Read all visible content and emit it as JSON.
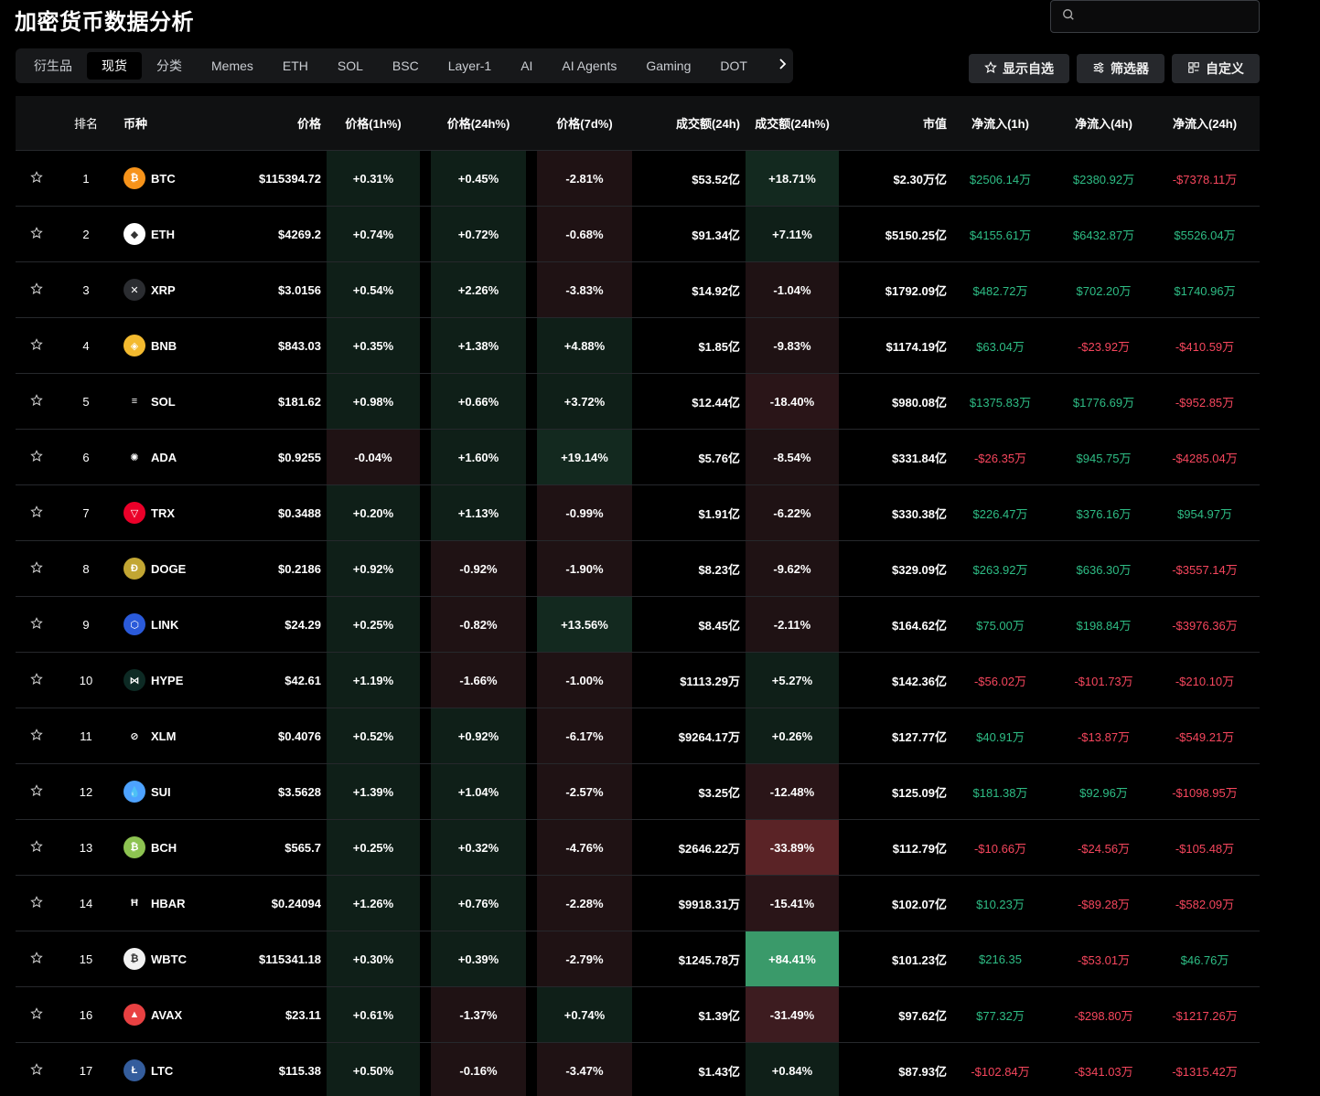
{
  "header": {
    "title": "加密货币数据分析",
    "search_placeholder": ""
  },
  "tabs": [
    {
      "label": "衍生品",
      "active": false
    },
    {
      "label": "现货",
      "active": true
    },
    {
      "label": "分类",
      "active": false
    },
    {
      "label": "Memes",
      "active": false
    },
    {
      "label": "ETH",
      "active": false
    },
    {
      "label": "SOL",
      "active": false
    },
    {
      "label": "BSC",
      "active": false
    },
    {
      "label": "Layer-1",
      "active": false
    },
    {
      "label": "AI",
      "active": false
    },
    {
      "label": "AI Agents",
      "active": false
    },
    {
      "label": "Gaming",
      "active": false
    },
    {
      "label": "DOT",
      "active": false
    }
  ],
  "actions": {
    "watchlist": "显示自选",
    "filter": "筛选器",
    "customize": "自定义"
  },
  "columns": {
    "rank": "排名",
    "coin": "币种",
    "price": "价格",
    "p1h": "价格(1h%)",
    "p24h": "价格(24h%)",
    "p7d": "价格(7d%)",
    "vol": "成交额(24h)",
    "vol24": "成交额(24h%)",
    "mcap": "市值",
    "f1h": "净流入(1h)",
    "f4h": "净流入(4h)",
    "f24h": "净流入(24h)"
  },
  "rows": [
    {
      "rank": "1",
      "sym": "BTC",
      "icon": "bitcoin-icon",
      "iconBg": "#f7931a",
      "glyph": "₿",
      "price": "$115394.72",
      "p1h": "+0.31%",
      "p1hBg": "g1",
      "p24h": "+0.45%",
      "p24hBg": "g1",
      "p7d": "-2.81%",
      "p7dBg": "r1",
      "vol": "$53.52亿",
      "vol24": "+18.71%",
      "vol24Bg": "g2",
      "mcap": "$2.30万亿",
      "f1h": "$2506.14万",
      "f4h": "$2380.92万",
      "f24h": "-$7378.11万"
    },
    {
      "rank": "2",
      "sym": "ETH",
      "icon": "ethereum-icon",
      "iconBg": "#ffffff",
      "glyph": "◆",
      "price": "$4269.2",
      "p1h": "+0.74%",
      "p1hBg": "g1",
      "p24h": "+0.72%",
      "p24hBg": "g1",
      "p7d": "-0.68%",
      "p7dBg": "r1",
      "vol": "$91.34亿",
      "vol24": "+7.11%",
      "vol24Bg": "g1",
      "mcap": "$5150.25亿",
      "f1h": "$4155.61万",
      "f4h": "$6432.87万",
      "f24h": "$5526.04万"
    },
    {
      "rank": "3",
      "sym": "XRP",
      "icon": "xrp-icon",
      "iconBg": "#2b2d31",
      "glyph": "✕",
      "price": "$3.0156",
      "p1h": "+0.54%",
      "p1hBg": "g1",
      "p24h": "+2.26%",
      "p24hBg": "g1",
      "p7d": "-3.83%",
      "p7dBg": "r1",
      "vol": "$14.92亿",
      "vol24": "-1.04%",
      "vol24Bg": "r1",
      "mcap": "$1792.09亿",
      "f1h": "$482.72万",
      "f4h": "$702.20万",
      "f24h": "$1740.96万"
    },
    {
      "rank": "4",
      "sym": "BNB",
      "icon": "bnb-icon",
      "iconBg": "#f3ba2f",
      "glyph": "◈",
      "price": "$843.03",
      "p1h": "+0.35%",
      "p1hBg": "g1",
      "p24h": "+1.38%",
      "p24hBg": "g1",
      "p7d": "+4.88%",
      "p7dBg": "g1",
      "vol": "$1.85亿",
      "vol24": "-9.83%",
      "vol24Bg": "r1",
      "mcap": "$1174.19亿",
      "f1h": "$63.04万",
      "f4h": "-$23.92万",
      "f24h": "-$410.59万"
    },
    {
      "rank": "5",
      "sym": "SOL",
      "icon": "solana-icon",
      "iconBg": "#000000",
      "glyph": "≡",
      "price": "$181.62",
      "p1h": "+0.98%",
      "p1hBg": "g1",
      "p24h": "+0.66%",
      "p24hBg": "g1",
      "p7d": "+3.72%",
      "p7dBg": "g1",
      "vol": "$12.44亿",
      "vol24": "-18.40%",
      "vol24Bg": "r2",
      "mcap": "$980.08亿",
      "f1h": "$1375.83万",
      "f4h": "$1776.69万",
      "f24h": "-$952.85万"
    },
    {
      "rank": "6",
      "sym": "ADA",
      "icon": "cardano-icon",
      "iconBg": "#000000",
      "glyph": "✺",
      "price": "$0.9255",
      "p1h": "-0.04%",
      "p1hBg": "r1",
      "p24h": "+1.60%",
      "p24hBg": "g1",
      "p7d": "+19.14%",
      "p7dBg": "g2",
      "vol": "$5.76亿",
      "vol24": "-8.54%",
      "vol24Bg": "r1",
      "mcap": "$331.84亿",
      "f1h": "-$26.35万",
      "f4h": "$945.75万",
      "f24h": "-$4285.04万"
    },
    {
      "rank": "7",
      "sym": "TRX",
      "icon": "tron-icon",
      "iconBg": "#eb0029",
      "glyph": "▽",
      "price": "$0.3488",
      "p1h": "+0.20%",
      "p1hBg": "g1",
      "p24h": "+1.13%",
      "p24hBg": "g1",
      "p7d": "-0.99%",
      "p7dBg": "r1",
      "vol": "$1.91亿",
      "vol24": "-6.22%",
      "vol24Bg": "r1",
      "mcap": "$330.38亿",
      "f1h": "$226.47万",
      "f4h": "$376.16万",
      "f24h": "$954.97万"
    },
    {
      "rank": "8",
      "sym": "DOGE",
      "icon": "dogecoin-icon",
      "iconBg": "#c2a633",
      "glyph": "Ð",
      "price": "$0.2186",
      "p1h": "+0.92%",
      "p1hBg": "g1",
      "p24h": "-0.92%",
      "p24hBg": "r1",
      "p7d": "-1.90%",
      "p7dBg": "r1",
      "vol": "$8.23亿",
      "vol24": "-9.62%",
      "vol24Bg": "r1",
      "mcap": "$329.09亿",
      "f1h": "$263.92万",
      "f4h": "$636.30万",
      "f24h": "-$3557.14万"
    },
    {
      "rank": "9",
      "sym": "LINK",
      "icon": "chainlink-icon",
      "iconBg": "#2a5ada",
      "glyph": "⬡",
      "price": "$24.29",
      "p1h": "+0.25%",
      "p1hBg": "g1",
      "p24h": "-0.82%",
      "p24hBg": "r1",
      "p7d": "+13.56%",
      "p7dBg": "g2",
      "vol": "$8.45亿",
      "vol24": "-2.11%",
      "vol24Bg": "r1",
      "mcap": "$164.62亿",
      "f1h": "$75.00万",
      "f4h": "$198.84万",
      "f24h": "-$3976.36万"
    },
    {
      "rank": "10",
      "sym": "HYPE",
      "icon": "hyperliquid-icon",
      "iconBg": "#0d2a24",
      "glyph": "⋈",
      "price": "$42.61",
      "p1h": "+1.19%",
      "p1hBg": "g1",
      "p24h": "-1.66%",
      "p24hBg": "r1",
      "p7d": "-1.00%",
      "p7dBg": "r1",
      "vol": "$1113.29万",
      "vol24": "+5.27%",
      "vol24Bg": "g1",
      "mcap": "$142.36亿",
      "f1h": "-$56.02万",
      "f4h": "-$101.73万",
      "f24h": "-$210.10万"
    },
    {
      "rank": "11",
      "sym": "XLM",
      "icon": "stellar-icon",
      "iconBg": "#000000",
      "glyph": "⊘",
      "price": "$0.4076",
      "p1h": "+0.52%",
      "p1hBg": "g1",
      "p24h": "+0.92%",
      "p24hBg": "g1",
      "p7d": "-6.17%",
      "p7dBg": "r1",
      "vol": "$9264.17万",
      "vol24": "+0.26%",
      "vol24Bg": "g1",
      "mcap": "$127.77亿",
      "f1h": "$40.91万",
      "f4h": "-$13.87万",
      "f24h": "-$549.21万"
    },
    {
      "rank": "12",
      "sym": "SUI",
      "icon": "sui-icon",
      "iconBg": "#4da2ff",
      "glyph": "💧",
      "price": "$3.5628",
      "p1h": "+1.39%",
      "p1hBg": "g1",
      "p24h": "+1.04%",
      "p24hBg": "g1",
      "p7d": "-2.57%",
      "p7dBg": "r1",
      "vol": "$3.25亿",
      "vol24": "-12.48%",
      "vol24Bg": "r2",
      "mcap": "$125.09亿",
      "f1h": "$181.38万",
      "f4h": "$92.96万",
      "f24h": "-$1098.95万"
    },
    {
      "rank": "13",
      "sym": "BCH",
      "icon": "bitcoin-cash-icon",
      "iconBg": "#8dc351",
      "glyph": "₿",
      "price": "$565.7",
      "p1h": "+0.25%",
      "p1hBg": "g1",
      "p24h": "+0.32%",
      "p24hBg": "g1",
      "p7d": "-4.76%",
      "p7dBg": "r1",
      "vol": "$2646.22万",
      "vol24": "-33.89%",
      "vol24Bg": "r4",
      "mcap": "$112.79亿",
      "f1h": "-$10.66万",
      "f4h": "-$24.56万",
      "f24h": "-$105.48万"
    },
    {
      "rank": "14",
      "sym": "HBAR",
      "icon": "hedera-icon",
      "iconBg": "#000000",
      "glyph": "Ħ",
      "price": "$0.24094",
      "p1h": "+1.26%",
      "p1hBg": "g1",
      "p24h": "+0.76%",
      "p24hBg": "g1",
      "p7d": "-2.28%",
      "p7dBg": "r1",
      "vol": "$9918.31万",
      "vol24": "-15.41%",
      "vol24Bg": "r2",
      "mcap": "$102.07亿",
      "f1h": "$10.23万",
      "f4h": "-$89.28万",
      "f24h": "-$582.09万"
    },
    {
      "rank": "15",
      "sym": "WBTC",
      "icon": "wrapped-bitcoin-icon",
      "iconBg": "#f2f2f2",
      "glyph": "₿",
      "price": "$115341.18",
      "p1h": "+0.30%",
      "p1hBg": "g1",
      "p24h": "+0.39%",
      "p24hBg": "g1",
      "p7d": "-2.79%",
      "p7dBg": "r1",
      "vol": "$1245.78万",
      "vol24": "+84.41%",
      "vol24Bg": "g4",
      "mcap": "$101.23亿",
      "f1h": "$216.35",
      "f4h": "-$53.01万",
      "f24h": "$46.76万"
    },
    {
      "rank": "16",
      "sym": "AVAX",
      "icon": "avalanche-icon",
      "iconBg": "#e84142",
      "glyph": "▲",
      "price": "$23.11",
      "p1h": "+0.61%",
      "p1hBg": "g1",
      "p24h": "-1.37%",
      "p24hBg": "r1",
      "p7d": "+0.74%",
      "p7dBg": "g1",
      "vol": "$1.39亿",
      "vol24": "-31.49%",
      "vol24Bg": "r3",
      "mcap": "$97.62亿",
      "f1h": "$77.32万",
      "f4h": "-$298.80万",
      "f24h": "-$1217.26万"
    },
    {
      "rank": "17",
      "sym": "LTC",
      "icon": "litecoin-icon",
      "iconBg": "#345d9d",
      "glyph": "Ł",
      "price": "$115.38",
      "p1h": "+0.50%",
      "p1hBg": "g1",
      "p24h": "-0.16%",
      "p24hBg": "r1",
      "p7d": "-3.47%",
      "p7dBg": "r1",
      "vol": "$1.43亿",
      "vol24": "+0.84%",
      "vol24Bg": "g1",
      "mcap": "$87.93亿",
      "f1h": "-$102.84万",
      "f4h": "-$341.03万",
      "f24h": "-$1315.42万"
    }
  ]
}
